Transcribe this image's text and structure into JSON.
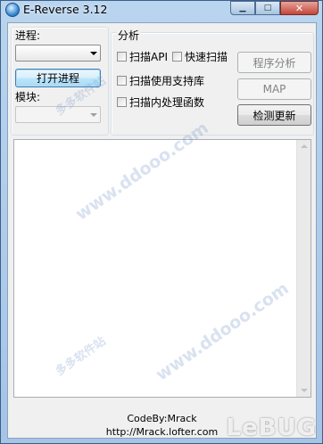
{
  "window": {
    "title": "E-Reverse 3.12"
  },
  "caption_buttons": {
    "minimize": "▁",
    "maximize": "□",
    "close": "✕"
  },
  "process": {
    "label": "进程:",
    "selected": "",
    "open_button": "打开进程"
  },
  "module": {
    "label": "模块:",
    "selected": ""
  },
  "analysis": {
    "label": "分析",
    "checkboxes": [
      {
        "label": "扫描API",
        "checked": false
      },
      {
        "label": "快速扫描",
        "checked": false
      },
      {
        "label": "扫描使用支持库",
        "checked": false
      },
      {
        "label": "扫描内处理函数",
        "checked": false
      }
    ],
    "buttons": {
      "program_analysis": "程序分析",
      "map": "MAP",
      "check_update": "检测更新"
    }
  },
  "log": {
    "content": ""
  },
  "footer": {
    "line1": "CodeBy:Mrack",
    "line2": "http://Mrack.lofter.com"
  },
  "watermarks": {
    "site_cn": "多多软件站",
    "site_url": "www.ddooo.com",
    "brand": "LeBUG"
  }
}
